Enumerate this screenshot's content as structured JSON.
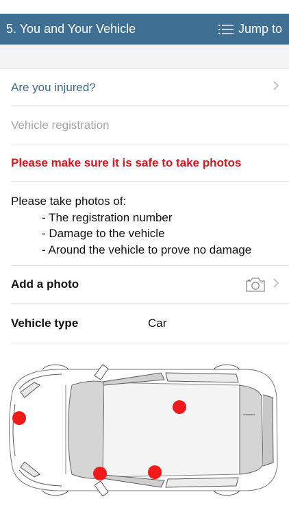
{
  "header": {
    "title": "5. You and Your Vehicle",
    "jump_label": "Jump to"
  },
  "injured": {
    "label": "Are you injured?"
  },
  "registration": {
    "placeholder": "Vehicle registration",
    "value": ""
  },
  "warning": {
    "text": "Please make sure it is safe to take photos"
  },
  "instructions": {
    "intro": "Please take photos of:",
    "items": [
      "- The registration number",
      "- Damage to the vehicle",
      "- Around the vehicle to prove no damage"
    ]
  },
  "add_photo": {
    "label": "Add a photo",
    "icon": "camera-icon"
  },
  "vehicle_type": {
    "label": "Vehicle type",
    "value": "Car"
  },
  "diagram": {
    "marker_color": "#f01a1a"
  }
}
